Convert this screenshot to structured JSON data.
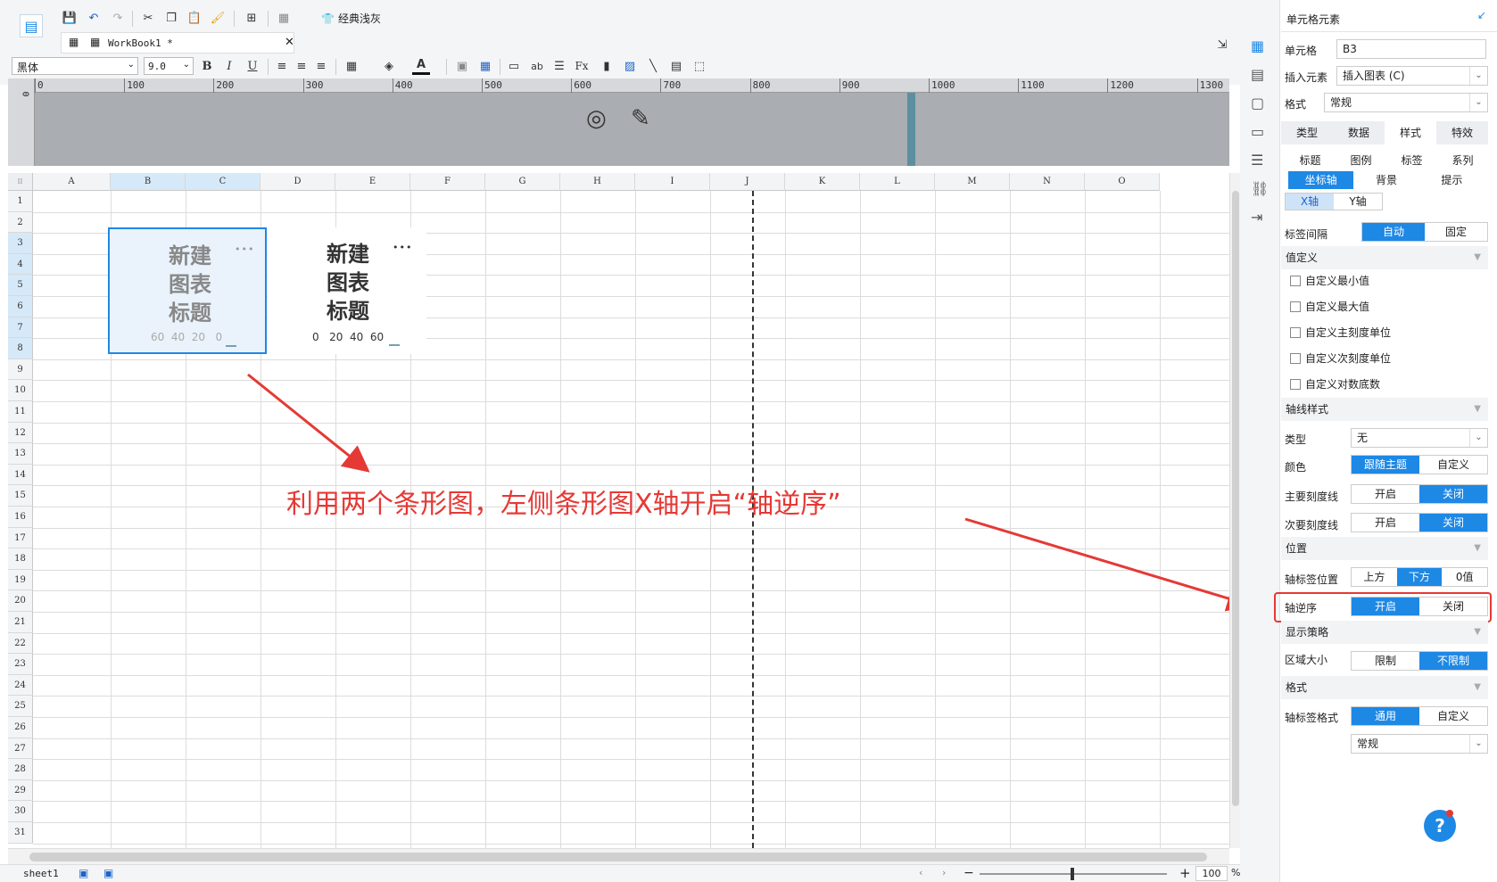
{
  "toolbar": {
    "theme_label": "经典浅灰",
    "tab_label": "WorkBook1 *",
    "font_name": "黑体",
    "font_size": "9.0",
    "bold": "B",
    "italic": "I",
    "underline": "U"
  },
  "ruler": {
    "ticks": [
      "0",
      "100",
      "200",
      "300",
      "400",
      "500",
      "600",
      "700",
      "800",
      "900",
      "1000",
      "1100",
      "1200",
      "1300"
    ],
    "v_zero": "0"
  },
  "columns": [
    "A",
    "B",
    "C",
    "D",
    "E",
    "F",
    "G",
    "H",
    "I",
    "J",
    "K",
    "L",
    "M",
    "N",
    "O"
  ],
  "rows": [
    "1",
    "2",
    "3",
    "4",
    "5",
    "6",
    "7",
    "8",
    "9",
    "10",
    "11",
    "12",
    "13",
    "14",
    "15",
    "16",
    "17",
    "18",
    "19",
    "20",
    "21",
    "22",
    "23",
    "24",
    "25",
    "26",
    "27",
    "28",
    "29",
    "30",
    "31"
  ],
  "chart_left": {
    "title_l1": "新建",
    "title_l2": "图表",
    "title_l3": "标题",
    "axis": "60  40  20   0",
    "more": "•••"
  },
  "chart_right": {
    "title_l1": "新建",
    "title_l2": "图表",
    "title_l3": "标题",
    "axis": "0   20  40  60",
    "more": "•••"
  },
  "annotation": "利用两个条形图，左侧条形图X轴开启“轴逆序”",
  "status": {
    "sheet": "sheet1",
    "zoom": "100",
    "pct": "%",
    "minus": "−",
    "plus": "+"
  },
  "panel": {
    "header": "单元格元素",
    "cell_label": "单元格",
    "cell_value": "B3",
    "insert_label": "插入元素",
    "insert_value": "插入图表 (C)",
    "format_label": "格式",
    "format_value": "常规",
    "tabs": [
      "类型",
      "数据",
      "样式",
      "特效"
    ],
    "subtabs1": [
      "标题",
      "图例",
      "标签",
      "系列"
    ],
    "subtabs2": [
      "坐标轴",
      "背景",
      "提示"
    ],
    "axis_tabs": [
      "X轴",
      "Y轴"
    ],
    "label_interval": "标签间隔",
    "auto": "自动",
    "fixed": "固定",
    "custom_section": "值定义",
    "checkboxes": [
      "自定义最小值",
      "自定义最大值",
      "自定义主刻度单位",
      "自定义次刻度单位",
      "自定义对数底数"
    ],
    "axis_style": "轴线样式",
    "type_label": "类型",
    "type_value": "无",
    "color_label": "颜色",
    "follow_theme": "跟随主题",
    "custom": "自定义",
    "major_tick": "主要刻度线",
    "minor_tick": "次要刻度线",
    "on": "开启",
    "off": "关闭",
    "position": "位置",
    "label_pos": "轴标签位置",
    "top": "上方",
    "bottom": "下方",
    "zero": "0值",
    "reverse": "轴逆序",
    "display": "显示策略",
    "area_size": "区域大小",
    "limit": "限制",
    "nolimit": "不限制",
    "format_sect": "格式",
    "label_format": "轴标签格式",
    "general": "通用",
    "format_bottom": "常规"
  },
  "colors": {
    "accent": "#1e88e5",
    "annotation": "#e53935"
  }
}
